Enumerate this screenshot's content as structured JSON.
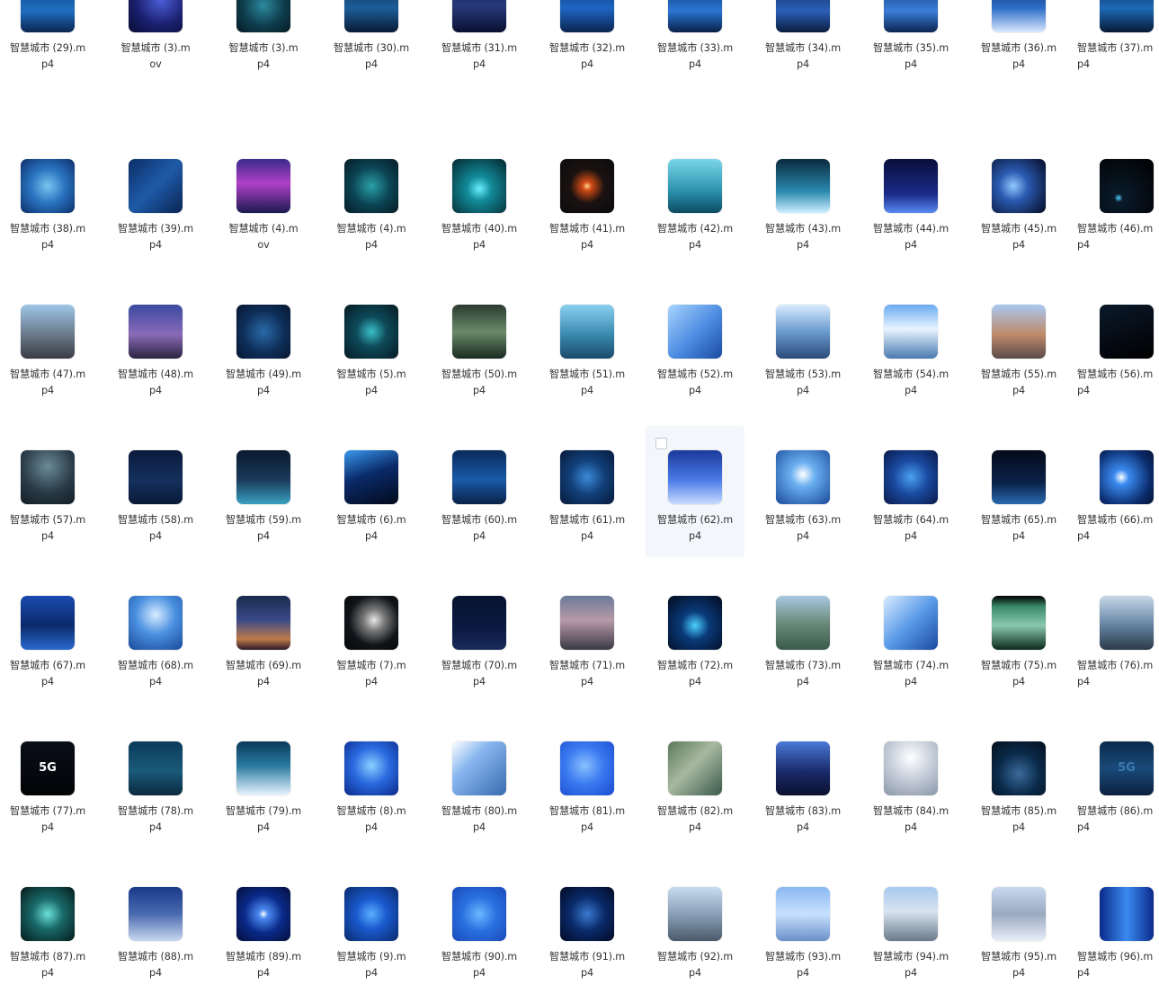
{
  "window": {
    "view": "large-icons"
  },
  "icon_kind": "video-thumbnail",
  "hover_index": 39,
  "items": [
    {
      "l1": "智慧城市 (29).m",
      "l2": "p4",
      "bg": "linear-gradient(180deg,#0b3d7a 0%,#1f6fc0 60%,#0a2550 100%)"
    },
    {
      "l1": "智慧城市 (3).m",
      "l2": "ov",
      "bg": "radial-gradient(circle at 60% 40%,#4b5fd8 0%,#1a1f6e 55%,#0a0d35 100%)"
    },
    {
      "l1": "智慧城市 (3).m",
      "l2": "p4",
      "bg": "radial-gradient(circle at 50% 50%,#2c8a9e 0%,#0e3c4c 55%,#061c24 100%)"
    },
    {
      "l1": "智慧城市 (30).m",
      "l2": "p4",
      "bg": "linear-gradient(180deg,#0d2a4d 0%,#1d5d9a 55%,#081a33 100%)"
    },
    {
      "l1": "智慧城市 (31).m",
      "l2": "p4",
      "bg": "linear-gradient(180deg,#1a1f48 0%,#263a7a 50%,#0a1030 100%)"
    },
    {
      "l1": "智慧城市 (32).m",
      "l2": "p4",
      "bg": "linear-gradient(180deg,#0a2f66 0%,#1e66c4 55%,#0b2450 100%)"
    },
    {
      "l1": "智慧城市 (33).m",
      "l2": "p4",
      "bg": "linear-gradient(180deg,#0a2a5c 0%,#2a76d4 60%,#0a2048 100%)"
    },
    {
      "l1": "智慧城市 (34).m",
      "l2": "p4",
      "bg": "linear-gradient(180deg,#0b2150 0%,#2b5fb8 60%,#0a1d40 100%)"
    },
    {
      "l1": "智慧城市 (35).m",
      "l2": "p4",
      "bg": "linear-gradient(180deg,#0a2e6a 0%,#3a7ed8 60%,#0b2552 100%)"
    },
    {
      "l1": "智慧城市 (36).m",
      "l2": "p4",
      "bg": "linear-gradient(180deg,#0b2d62 0%,#2c6ec8 55%,#dbe8ff 100%)"
    },
    {
      "l1": "智慧城市 (37).m",
      "l2": "p4",
      "bg": "linear-gradient(180deg,#082040 0%,#1e6ab8 55%,#061a36 100%)"
    },
    {
      "l1": "智慧城市 (38).m",
      "l2": "p4",
      "bg": "radial-gradient(circle at 50% 50%,#7ac4f0 0%,#2a74c0 45%,#0c2e6a 100%)"
    },
    {
      "l1": "智慧城市 (39).m",
      "l2": "p4",
      "bg": "linear-gradient(135deg,#0b2e66 0%,#1e5aa8 50%,#0a2452 100%)"
    },
    {
      "l1": "智慧城市 (4).m",
      "l2": "ov",
      "bg": "linear-gradient(180deg,#3a2a8a 0%,#b040c8 45%,#1c1a50 100%)"
    },
    {
      "l1": "智慧城市 (4).m",
      "l2": "p4",
      "bg": "radial-gradient(circle at 50% 50%,#2aa0a8 0%,#0c4454 50%,#041c24 100%)"
    },
    {
      "l1": "智慧城市 (40).m",
      "l2": "p4",
      "bg": "radial-gradient(circle at 50% 55%,#6af0ff 0%,#128c9a 30%,#04262e 100%)"
    },
    {
      "l1": "智慧城市 (41).m",
      "l2": "p4",
      "bg": "radial-gradient(circle at 50% 50%,#ffd08a 0%,#d04a14 12%,#1a1210 45%,#0a0a0e 100%)"
    },
    {
      "l1": "智慧城市 (42).m",
      "l2": "p4",
      "bg": "linear-gradient(180deg,#7ad6e8 0%,#2a90ac 60%,#0e4a62 100%)"
    },
    {
      "l1": "智慧城市 (43).m",
      "l2": "p4",
      "bg": "linear-gradient(180deg,#0a2a3e 0%,#2a8ab0 60%,#cfefff 100%)"
    },
    {
      "l1": "智慧城市 (44).m",
      "l2": "p4",
      "bg": "linear-gradient(180deg,#0a0f3a 0%,#1a2a8a 65%,#5a8af0 100%)"
    },
    {
      "l1": "智慧城市 (45).m",
      "l2": "p4",
      "bg": "radial-gradient(circle at 40% 50%,#8fc8ff 0%,#2a5ab0 35%,#050a22 100%)"
    },
    {
      "l1": "智慧城市 (46).m",
      "l2": "p4",
      "bg": "radial-gradient(circle at 35% 72%,#4ad0ff 0%,#0a1a2a 8%,#000000 100%)"
    },
    {
      "l1": "智慧城市 (47).m",
      "l2": "p4",
      "bg": "linear-gradient(180deg,#9ec6e8 0%,#6a7a8a 55%,#3a3a44 100%)"
    },
    {
      "l1": "智慧城市 (48).m",
      "l2": "p4",
      "bg": "linear-gradient(180deg,#3a4aa0 0%,#8a6ab8 55%,#2a2440 100%)"
    },
    {
      "l1": "智慧城市 (49).m",
      "l2": "p4",
      "bg": "radial-gradient(circle at 50% 50%,#2a6aa8 0%,#0e2e58 55%,#061630 100%)"
    },
    {
      "l1": "智慧城市 (5).m",
      "l2": "p4",
      "bg": "radial-gradient(circle at 50% 50%,#3ac0c8 0%,#0e4a5a 40%,#041a22 100%)"
    },
    {
      "l1": "智慧城市 (50).m",
      "l2": "p4",
      "bg": "linear-gradient(180deg,#2a3a30 0%,#6a8a6a 50%,#1a2a20 100%)"
    },
    {
      "l1": "智慧城市 (51).m",
      "l2": "p4",
      "bg": "linear-gradient(180deg,#8ad0f0 0%,#3a8ab0 55%,#1a4a6a 100%)"
    },
    {
      "l1": "智慧城市 (52).m",
      "l2": "p4",
      "bg": "linear-gradient(135deg,#a8d4ff 0%,#4a8ae0 55%,#1a4aa0 100%)"
    },
    {
      "l1": "智慧城市 (53).m",
      "l2": "p4",
      "bg": "linear-gradient(180deg,#d8ecff 0%,#6a9ad0 50%,#2a4a7a 100%)"
    },
    {
      "l1": "智慧城市 (54).m",
      "l2": "p4",
      "bg": "linear-gradient(180deg,#6aaaf0 0%,#e8f4ff 45%,#4a7ab0 100%)"
    },
    {
      "l1": "智慧城市 (55).m",
      "l2": "p4",
      "bg": "linear-gradient(180deg,#a8c8f0 0%,#c08a6a 55%,#5a4a4a 100%)"
    },
    {
      "l1": "智慧城市 (56).m",
      "l2": "p4",
      "bg": "linear-gradient(160deg,#0a1a2a 0%,#050a12 60%,#000000 100%)"
    },
    {
      "l1": "智慧城市 (57).m",
      "l2": "p4",
      "bg": "radial-gradient(circle at 50% 30%,#6a8a96 0%,#2a3c48 55%,#121c24 100%)"
    },
    {
      "l1": "智慧城市 (58).m",
      "l2": "p4",
      "bg": "linear-gradient(180deg,#0a1a3a 0%,#14305e 55%,#0a1a36 100%)"
    },
    {
      "l1": "智慧城市 (59).m",
      "l2": "p4",
      "bg": "linear-gradient(180deg,#0a1a2e 0%,#1a3a5a 55%,#3aa0c0 100%)"
    },
    {
      "l1": "智慧城市 (6).m",
      "l2": "p4",
      "bg": "linear-gradient(160deg,#3a9af0 0%,#0a2a6a 45%,#020a1a 100%)"
    },
    {
      "l1": "智慧城市 (60).m",
      "l2": "p4",
      "bg": "linear-gradient(180deg,#0a2a5a 0%,#1a5aa8 55%,#0a2248 100%)"
    },
    {
      "l1": "智慧城市 (61).m",
      "l2": "p4",
      "bg": "radial-gradient(circle at 50% 50%,#3a8ad8 0%,#12407a 45%,#061a3a 100%)"
    },
    {
      "l1": "智慧城市 (62).m",
      "l2": "p4",
      "bg": "linear-gradient(180deg,#1a3a9a 0%,#4a7ae8 55%,#c8dcff 100%)"
    },
    {
      "l1": "智慧城市 (63).m",
      "l2": "p4",
      "bg": "radial-gradient(circle at 50% 45%,#ffffff 0%,#6ab0f0 30%,#1a4a9a 100%)"
    },
    {
      "l1": "智慧城市 (64).m",
      "l2": "p4",
      "bg": "radial-gradient(circle at 50% 50%,#4aa0f0 0%,#1a4aa0 45%,#0a1a4a 100%)"
    },
    {
      "l1": "智慧城市 (65).m",
      "l2": "p4",
      "bg": "linear-gradient(180deg,#050a1a 0%,#0a2248 60%,#2a6ab0 100%)"
    },
    {
      "l1": "智慧城市 (66).m",
      "l2": "p4",
      "bg": "radial-gradient(circle at 40% 50%,#ffffff 0%,#3a8af0 18%,#0a2a6a 70%,#061636 100%)"
    },
    {
      "l1": "智慧城市 (67).m",
      "l2": "p4",
      "bg": "linear-gradient(180deg,#1a4ab0 0%,#0a2a6a 55%,#2a6ad0 100%)"
    },
    {
      "l1": "智慧城市 (68).m",
      "l2": "p4",
      "bg": "radial-gradient(circle at 50% 35%,#d8ecff 0%,#4a90e0 45%,#1a4a9a 100%)"
    },
    {
      "l1": "智慧城市 (69).m",
      "l2": "p4",
      "bg": "linear-gradient(180deg,#1a2a4a 0%,#3a4a8a 45%,#c07a4a 80%,#2a1a2a 100%)"
    },
    {
      "l1": "智慧城市 (7).m",
      "l2": "p4",
      "bg": "radial-gradient(circle at 55% 45%,#e8e8e8 0%,#7a7a7a 25%,#101418 60%,#050608 100%)"
    },
    {
      "l1": "智慧城市 (70).m",
      "l2": "p4",
      "bg": "linear-gradient(180deg,#061230 0%,#0a1a40 60%,#1a2a5a 100%)"
    },
    {
      "l1": "智慧城市 (71).m",
      "l2": "p4",
      "bg": "linear-gradient(180deg,#6a7a9a 0%,#b89aa8 45%,#3a3a44 100%)"
    },
    {
      "l1": "智慧城市 (72).m",
      "l2": "p4",
      "bg": "radial-gradient(circle at 50% 55%,#4ad0ff 0%,#0a3a7a 35%,#020a1c 100%)"
    },
    {
      "l1": "智慧城市 (73).m",
      "l2": "p4",
      "bg": "linear-gradient(180deg,#a8c8e0 0%,#6a8a7a 50%,#3a5a4a 100%)"
    },
    {
      "l1": "智慧城市 (74).m",
      "l2": "p4",
      "bg": "linear-gradient(135deg,#d8ecff 0%,#5a9ae8 50%,#1a4aa0 100%)"
    },
    {
      "l1": "智慧城市 (75).m",
      "l2": "p4",
      "bg": "linear-gradient(180deg,#000000 0%,#3a8a6a 20%,#8ac8b0 55%,#0a2a1a 100%)"
    },
    {
      "l1": "智慧城市 (76).m",
      "l2": "p4",
      "bg": "linear-gradient(180deg,#c8d8e8 0%,#6a8aa8 50%,#2a3a4a 100%)"
    },
    {
      "l1": "智慧城市 (77).m",
      "l2": "p4",
      "bg": "linear-gradient(180deg,#0a0e18 0%,#020406 100%)",
      "text": "5G"
    },
    {
      "l1": "智慧城市 (78).m",
      "l2": "p4",
      "bg": "linear-gradient(180deg,#0a3a5a 0%,#1a5a7a 55%,#0a2a40 100%)"
    },
    {
      "l1": "智慧城市 (79).m",
      "l2": "p4",
      "bg": "linear-gradient(180deg,#0a3a5a 0%,#2a7aa0 45%,#e8f4ff 100%)"
    },
    {
      "l1": "智慧城市 (8).m",
      "l2": "p4",
      "bg": "radial-gradient(circle at 50% 45%,#8ad0ff 0%,#2a6ae0 45%,#0a2a8a 100%)"
    },
    {
      "l1": "智慧城市 (80).m",
      "l2": "p4",
      "bg": "linear-gradient(135deg,#ffffff 0%,#8ab8f0 35%,#3a6ab0 100%)"
    },
    {
      "l1": "智慧城市 (81).m",
      "l2": "p4",
      "bg": "radial-gradient(circle at 45% 45%,#8ac0ff 0%,#3a7af0 45%,#1a4ad0 100%)"
    },
    {
      "l1": "智慧城市 (82).m",
      "l2": "p4",
      "bg": "linear-gradient(135deg,#5a7a5a 0%,#a8b8a0 45%,#3a5a4a 100%)"
    },
    {
      "l1": "智慧城市 (83).m",
      "l2": "p4",
      "bg": "linear-gradient(180deg,#4a7ad8 0%,#1a2a6a 55%,#0a1030 100%)"
    },
    {
      "l1": "智慧城市 (84).m",
      "l2": "p4",
      "bg": "radial-gradient(circle at 50% 30%,#ffffff 0%,#c8d0dc 45%,#8a96a8 100%)"
    },
    {
      "l1": "智慧城市 (85).m",
      "l2": "p4",
      "bg": "radial-gradient(circle at 50% 60%,#3a6a9a 0%,#0a2a4a 50%,#050e1c 100%)"
    },
    {
      "l1": "智慧城市 (86).m",
      "l2": "p4",
      "bg": "linear-gradient(180deg,#0a2a4a 0%,#1a4a7a 50%,#0a2040 100%)",
      "text": "5G",
      "textColor": "#3a7ab0"
    },
    {
      "l1": "智慧城市 (87).m",
      "l2": "p4",
      "bg": "radial-gradient(circle at 50% 50%,#6ae0d8 0%,#1a6a6a 40%,#051a1a 100%)"
    },
    {
      "l1": "智慧城市 (88).m",
      "l2": "p4",
      "bg": "linear-gradient(180deg,#1a3a8a 0%,#4a6ab0 50%,#c8d8f0 100%)"
    },
    {
      "l1": "智慧城市 (89).m",
      "l2": "p4",
      "bg": "radial-gradient(circle at 50% 50%,#ffffff 0%,#4a8af0 12%,#0a2a8a 50%,#050e3a 100%)"
    },
    {
      "l1": "智慧城市 (9).m",
      "l2": "p4",
      "bg": "radial-gradient(circle at 50% 50%,#5ab0ff 0%,#1a5ad0 40%,#0a2a6a 100%)"
    },
    {
      "l1": "智慧城市 (90).m",
      "l2": "p4",
      "bg": "radial-gradient(circle at 50% 50%,#6ab8ff 0%,#2a70e0 45%,#1a4ab8 100%)"
    },
    {
      "l1": "智慧城市 (91).m",
      "l2": "p4",
      "bg": "radial-gradient(circle at 50% 50%,#3a7ad0 0%,#0a2a6a 45%,#020a24 100%)"
    },
    {
      "l1": "智慧城市 (92).m",
      "l2": "p4",
      "bg": "linear-gradient(180deg,#c8dcf0 0%,#8aa0b8 50%,#4a5a6a 100%)"
    },
    {
      "l1": "智慧城市 (93).m",
      "l2": "p4",
      "bg": "linear-gradient(180deg,#8ab8f0 0%,#c8e0ff 50%,#6a90c8 100%)"
    },
    {
      "l1": "智慧城市 (94).m",
      "l2": "p4",
      "bg": "linear-gradient(180deg,#a8c8f0 0%,#d8e4f0 45%,#6a7a8a 100%)"
    },
    {
      "l1": "智慧城市 (95).m",
      "l2": "p4",
      "bg": "linear-gradient(180deg,#c8d8f0 0%,#9aaac0 50%,#e8eef8 100%)"
    },
    {
      "l1": "智慧城市 (96).m",
      "l2": "p4",
      "bg": "linear-gradient(90deg,#0a2a8a 0%,#3a8af0 50%,#0a2a8a 100%)"
    }
  ]
}
